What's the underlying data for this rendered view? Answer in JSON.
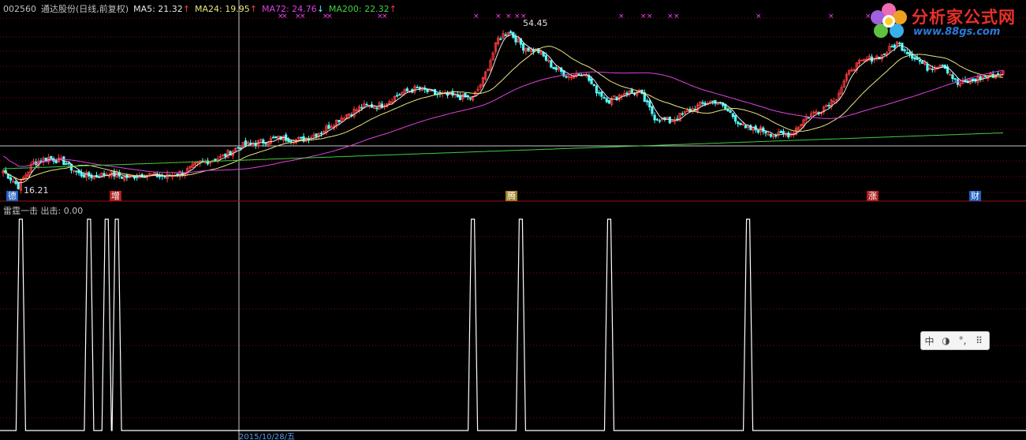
{
  "header": {
    "code": "002560",
    "name": "通达股份(日线,前复权)",
    "ma5_label": "MA5: 21.32",
    "ma24_label": "MA24: 19.95",
    "ma72_label": "MA72: 24.76",
    "ma200_label": "MA200: 22.32",
    "up_arrow": "↑",
    "down_arrow": "↓"
  },
  "colors": {
    "up": "#ff3c3c",
    "down": "#54fcfc",
    "ma5": "#e8e8e8",
    "ma24": "#e6e680",
    "ma72": "#e040e0",
    "ma200": "#40d040",
    "grid": "#7a1010",
    "marker": "#ff40ff"
  },
  "price_labels": {
    "high": "54.45",
    "low": "16.21"
  },
  "signal_tags": [
    {
      "text": "德",
      "color": "#2060c0",
      "x": 8
    },
    {
      "text": "增",
      "color": "#b02020",
      "x": 139
    },
    {
      "text": "腾",
      "color": "#a08020",
      "x": 641
    },
    {
      "text": "涨",
      "color": "#b02020",
      "x": 1099
    },
    {
      "text": "财",
      "color": "#2060c0",
      "x": 1229
    }
  ],
  "indicator": {
    "title": "雷霆一击",
    "value_label": "出击: 0.00"
  },
  "logo": {
    "title": "分析家公式网",
    "url": "www.88gs.com"
  },
  "ime": {
    "items": [
      "中",
      "◑",
      "°,",
      "⠿"
    ]
  },
  "axis": {
    "date_label": "2015/10/28/五"
  },
  "chart_data": {
    "type": "candlestick+indicator",
    "price_panel": {
      "ylim": [
        14,
        58
      ],
      "high_value": 54.45,
      "low_value": 16.21,
      "moving_averages": [
        "MA5",
        "MA24",
        "MA72",
        "MA200"
      ],
      "ma_last_values": {
        "MA5": 21.32,
        "MA24": 19.95,
        "MA72": 24.76,
        "MA200": 22.32
      }
    },
    "indicator_panel": {
      "name": "雷霆一击",
      "series": "出击",
      "last_value": 0.0,
      "pulse_candle_indices": [
        7,
        34,
        41,
        45,
        186,
        205,
        240,
        295
      ],
      "pulse_value": 1
    }
  }
}
